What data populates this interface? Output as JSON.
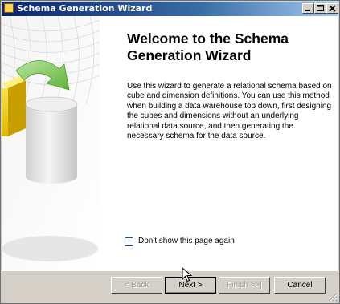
{
  "window": {
    "title": "Schema Generation Wizard",
    "icon": "wizard-app-icon"
  },
  "titlebar_buttons": {
    "minimize": "_",
    "maximize": "□",
    "close": "✕"
  },
  "page": {
    "heading": "Welcome to the Schema Generation Wizard",
    "description": "Use this wizard to generate a relational schema based on cube and dimension definitions. You can use this method when building a data warehouse top down, first designing the cubes and dimensions without an underlying relational data source, and then generating the necessary schema for the data source.",
    "dont_show_label": "Don't show this page again",
    "dont_show_checked": false
  },
  "buttons": {
    "back": "< Back",
    "next": "Next >",
    "finish": "Finish >>|",
    "cancel": "Cancel"
  },
  "colors": {
    "titlebar_start": "#0a246a",
    "titlebar_end": "#a6caf0",
    "chrome": "#d4d0c8"
  }
}
